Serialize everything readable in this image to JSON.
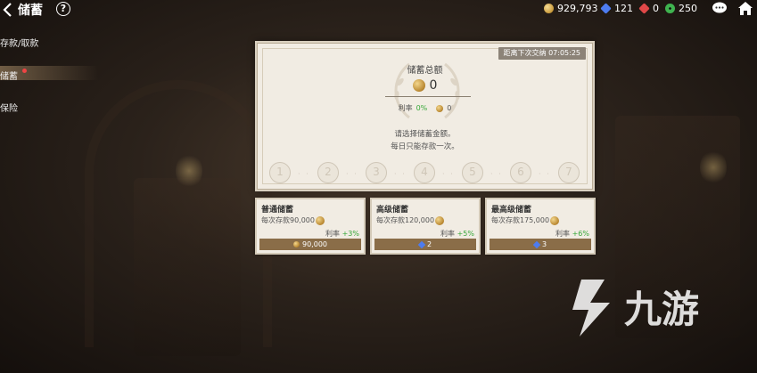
{
  "header": {
    "title": "储蓄",
    "help_label": "?"
  },
  "currencies": [
    {
      "icon": "gold-coin-icon",
      "value": "929,793",
      "color": "#d9a640"
    },
    {
      "icon": "blue-gem-icon",
      "value": "121",
      "color": "#4d7cf0"
    },
    {
      "icon": "red-gem-icon",
      "value": "0",
      "color": "#e04848"
    },
    {
      "icon": "green-gear-icon",
      "value": "250",
      "color": "#3fb34f"
    }
  ],
  "sidebar": {
    "items": [
      {
        "label": "存款/取款"
      },
      {
        "label": "储蓄"
      },
      {
        "label": "保险"
      }
    ],
    "active_index": 1
  },
  "panel": {
    "countdown_label": "距离下次交纳",
    "countdown_time": "07:05:25",
    "title": "储蓄总额",
    "total": "0",
    "rate_label": "利率",
    "rate_value": "0%",
    "rate_bonus": "0",
    "message_line1": "请选择储蓄金额。",
    "message_line2": "每日只能存款一次。",
    "steps": [
      "1",
      "2",
      "3",
      "4",
      "5",
      "6",
      "7"
    ],
    "step_dots": "· ·"
  },
  "options": [
    {
      "name": "普通储蓄",
      "amount_text": "每次存款90,000",
      "rate_label": "利率",
      "rate": "+3%",
      "cost": "90,000",
      "cost_icon": "gold-coin-icon"
    },
    {
      "name": "高级储蓄",
      "amount_text": "每次存款120,000",
      "rate_label": "利率",
      "rate": "+5%",
      "cost": "2",
      "cost_icon": "blue-gem-icon"
    },
    {
      "name": "最高级储蓄",
      "amount_text": "每次存款175,000",
      "rate_label": "利率",
      "rate": "+6%",
      "cost": "3",
      "cost_icon": "blue-gem-icon"
    }
  ],
  "watermark": {
    "text": "九游"
  },
  "colors": {
    "accent_green": "#38a83a",
    "panel_bg": "#f1ece3",
    "cost_bar": "#8a6d48"
  }
}
